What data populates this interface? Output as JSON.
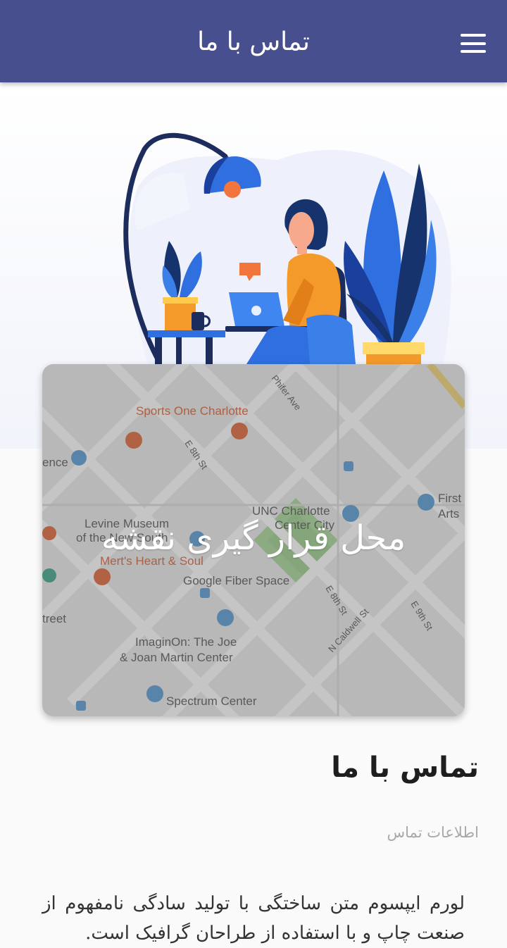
{
  "appbar": {
    "title": "تماس با ما",
    "menu_icon": "hamburger-menu-icon"
  },
  "hero": {
    "illustration": "woman-working-on-laptop-illustration"
  },
  "map": {
    "caption": "محل قرار گیری نقشه",
    "labels": {
      "sports": "Sports One Charlotte",
      "levine": "Levine Museum",
      "levine2": "of the New South",
      "merts": "Mert's Heart & Soul",
      "unc": "UNC Charlotte",
      "unc2": "Center City",
      "google": "Google Fiber Space",
      "imaginon": "ImaginOn: The Joe",
      "imaginon2": "& Joan Martin Center",
      "spectrum": "Spectrum Center",
      "first": "First",
      "arts": "Arts",
      "ence": "ence",
      "street": "treet",
      "phifer": "Phifer Ave",
      "e8th": "E 8th St",
      "e8th2": "E 8th St",
      "e9th": "E 9th St",
      "caldwell": "N Caldwell St"
    }
  },
  "content": {
    "heading": "تماس با ما",
    "subtitle": "اطلاعات تماس",
    "body": "لورم ایپسوم متن ساختگی با تولید سادگی نامفهوم از صنعت چاپ و با استفاده از طراحان گرافیک است."
  },
  "colors": {
    "appbar": "#474f8f",
    "accent_blue": "#2f6fe0",
    "orange": "#f39a2b"
  }
}
